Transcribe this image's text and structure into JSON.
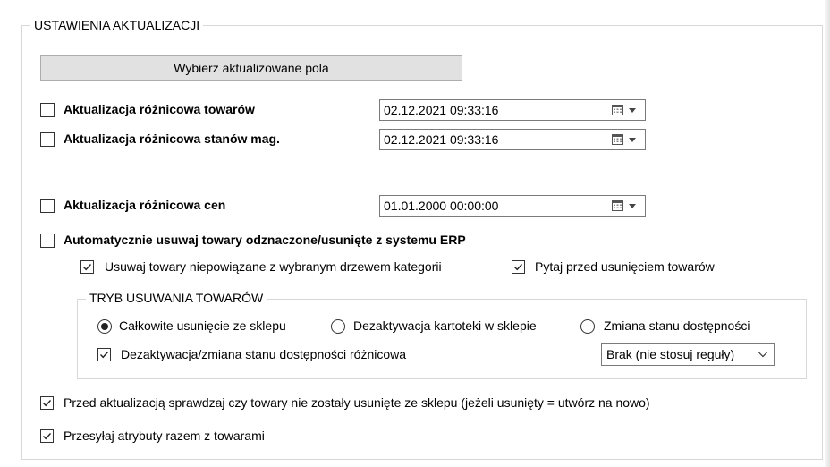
{
  "group": {
    "title": "USTAWIENIA AKTUALIZACJI"
  },
  "select_fields_button": "Wybierz aktualizowane pola",
  "diff_products": {
    "label": "Aktualizacja różnicowa towarów",
    "checked": false,
    "date": "02.12.2021 09:33:16"
  },
  "diff_stock": {
    "label": "Aktualizacja różnicowa stanów mag.",
    "checked": false,
    "date": "02.12.2021 09:33:16"
  },
  "diff_prices": {
    "label": "Aktualizacja różnicowa cen",
    "checked": false,
    "date": "01.01.2000 00:00:00"
  },
  "auto_delete": {
    "label": "Automatycznie usuwaj towary odznaczone/usunięte z systemu ERP",
    "checked": false
  },
  "delete_unrelated": {
    "label": "Usuwaj towary niepowiązane z wybranym drzewem kategorii",
    "checked": true
  },
  "ask_before_delete": {
    "label": "Pytaj przed usunięciem towarów",
    "checked": true
  },
  "delete_mode": {
    "title": "TRYB USUWANIA TOWARÓW",
    "options": [
      {
        "label": "Całkowite usunięcie ze sklepu",
        "selected": true
      },
      {
        "label": "Dezaktywacja kartoteki w sklepie",
        "selected": false
      },
      {
        "label": "Zmiana stanu dostępności",
        "selected": false
      }
    ],
    "diff_deactivation": {
      "label": "Dezaktywacja/zmiana stanu dostępności różnicowa",
      "checked": true
    },
    "rule_select": {
      "value": "Brak (nie stosuj reguły)"
    }
  },
  "check_deleted": {
    "label": "Przed aktualizacją sprawdzaj czy towary nie zostały usunięte ze sklepu (jeżeli usunięty = utwórz na nowo)",
    "checked": true
  },
  "send_attributes": {
    "label": "Przesyłaj atrybuty razem z towarami",
    "checked": true
  }
}
